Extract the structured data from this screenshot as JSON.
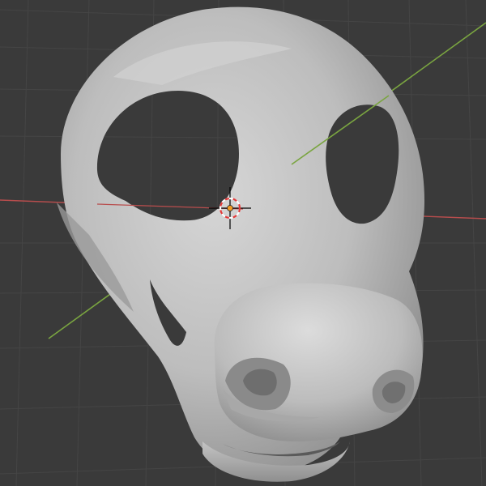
{
  "app": {
    "editor": "3D Viewport",
    "background_color": "#3a3a3a",
    "grid_color": "#454545"
  },
  "scene": {
    "x_axis_color": "#b84d4d",
    "y_axis_color": "#7aa540",
    "mesh_color": "#b9b9b9",
    "mesh_shadow_color": "#7e7e7e",
    "mesh_highlight_color": "#dadada",
    "cursor_ring_colors": [
      "#e23a3a",
      "#ffffff"
    ],
    "origin_color": "#f29a24"
  },
  "icons": {
    "cursor": "3d-cursor-icon",
    "origin": "object-origin-icon"
  }
}
